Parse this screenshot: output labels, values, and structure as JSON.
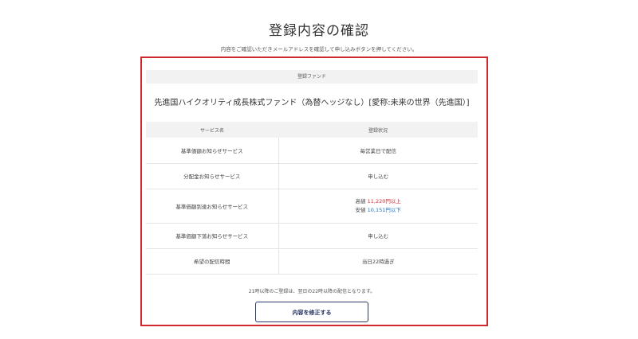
{
  "page": {
    "title": "登録内容の確認",
    "description": "内容をご確認いただきメールアドレスを確認して申し込みボタンを押してください。"
  },
  "fund_section": {
    "header": "登録ファンド",
    "fund_name": "先進国ハイクオリティ成長株式ファンド（為替ヘッジなし）[愛称:未来の世界（先進国）]"
  },
  "service_table": {
    "headers": [
      "サービス名",
      "登録状況"
    ],
    "rows": [
      {
        "name": "基準価額お知らせサービス",
        "status": "毎営業日で配信"
      },
      {
        "name": "分配金お知らせサービス",
        "status": "申し込む"
      },
      {
        "name": "基準価額到達お知らせサービス",
        "high_label": "高値",
        "high_value": "11,220円以上",
        "low_label": "安値",
        "low_value": "10,151円以下"
      },
      {
        "name": "基準価額下落お知らせサービス",
        "status": "申し込む"
      },
      {
        "name": "希望の配信時間",
        "status": "当日22時過ぎ"
      }
    ]
  },
  "note": "21時以降のご登録は、翌日の22時以降の配信となります。",
  "buttons": {
    "edit_label": "内容を修正する"
  },
  "colors": {
    "frame_highlight": "#d0282d",
    "high_value": "#d0282d",
    "low_value": "#1a6fc9",
    "button_border": "#2b3a6b"
  }
}
